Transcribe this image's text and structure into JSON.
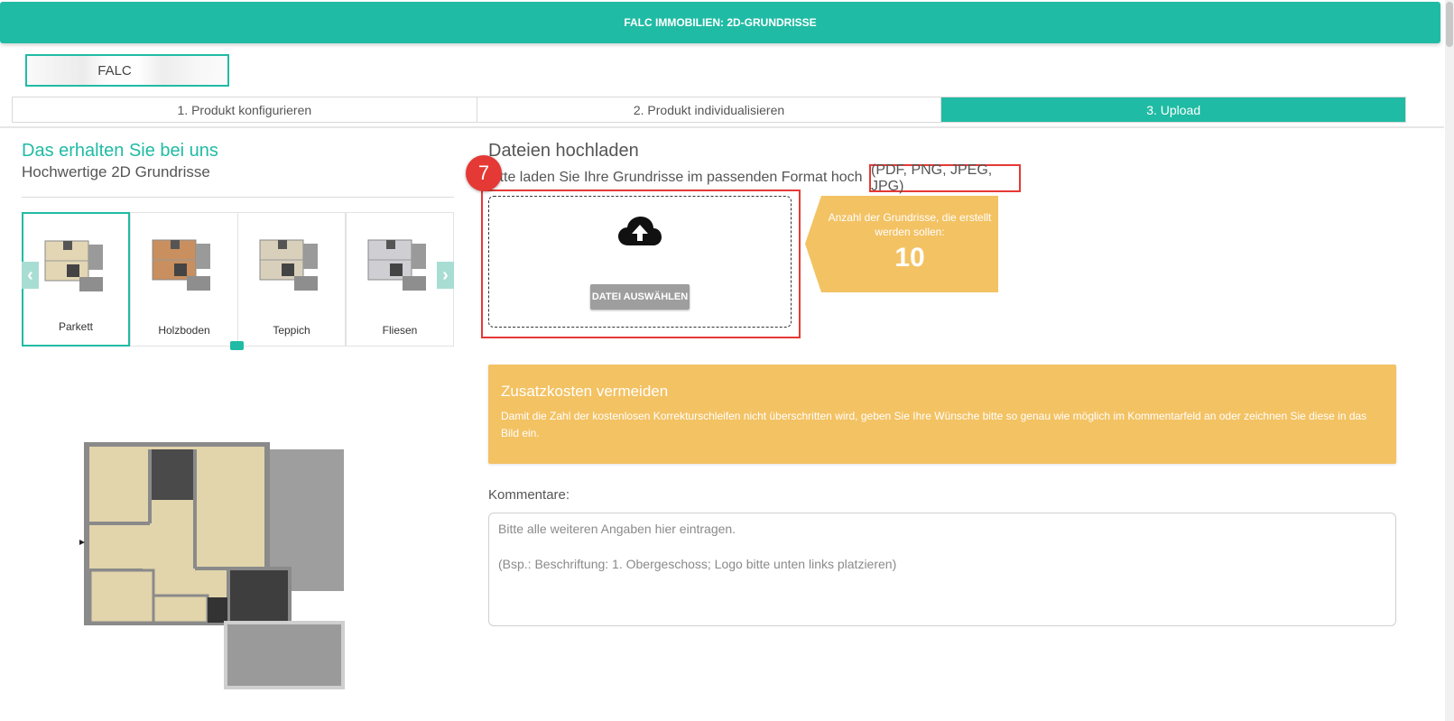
{
  "header": {
    "title": "FALC IMMOBILIEN: 2D-GRUNDRISSE"
  },
  "logo": {
    "text": "FALC"
  },
  "steps": [
    {
      "label": "1. Produkt konfigurieren",
      "active": false
    },
    {
      "label": "2. Produkt individualisieren",
      "active": false
    },
    {
      "label": "3. Upload",
      "active": true
    }
  ],
  "left": {
    "title": "Das erhalten Sie bei uns",
    "subtitle": "Hochwertige 2D Grundrisse",
    "carousel": {
      "items": [
        {
          "label": "Parkett",
          "selected": true
        },
        {
          "label": "Holzboden",
          "selected": false
        },
        {
          "label": "Teppich",
          "selected": false
        },
        {
          "label": "Fliesen",
          "selected": false
        }
      ],
      "prev_icon": "chevron-left-icon",
      "next_icon": "chevron-right-icon"
    }
  },
  "upload": {
    "title": "Dateien hochladen",
    "hint": "itte laden Sie Ihre Grundrisse im passenden Format hoch",
    "formats": "(PDF, PNG, JPEG, JPG)",
    "badge": "7",
    "button_label": "DATEI AUSWÄHLEN",
    "icon": "cloud-upload-icon"
  },
  "count": {
    "label": "Anzahl der Grundrisse, die erstellt werden sollen:",
    "value": "10"
  },
  "alert": {
    "title": "Zusatzkosten vermeiden",
    "text": "Damit die Zahl der kostenlosen Korrekturschleifen nicht überschritten wird, geben Sie Ihre Wünsche bitte so genau wie möglich im Kommentarfeld an oder zeichnen Sie diese in das Bild ein."
  },
  "comments": {
    "label": "Kommentare:",
    "placeholder": "Bitte alle weiteren Angaben hier eintragen.\n\n(Bsp.: Beschriftung: 1. Obergeschoss; Logo bitte unten links platzieren)"
  },
  "colors": {
    "accent": "#20bba4",
    "warning": "#f3c263",
    "highlight": "#e53935"
  }
}
